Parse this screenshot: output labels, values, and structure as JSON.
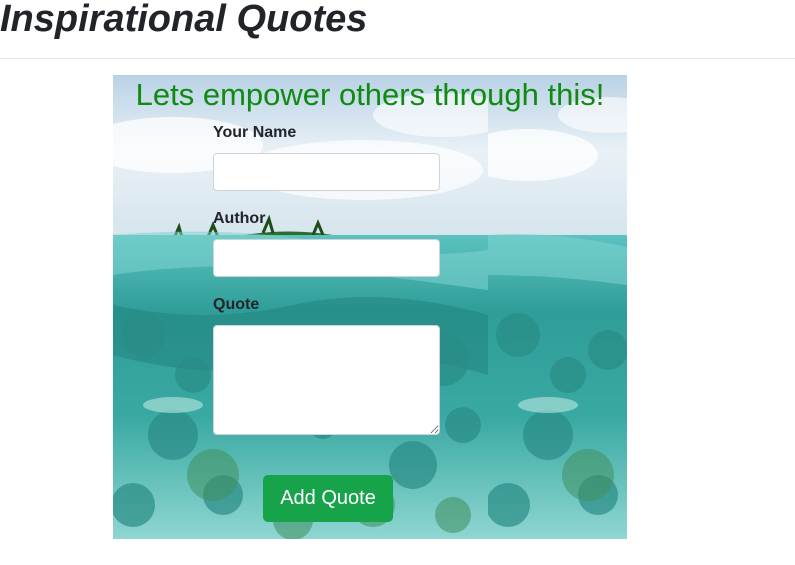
{
  "page": {
    "title": "Inspirational Quotes"
  },
  "hero": {
    "heading": "Lets empower others through this!",
    "heading_color": "#118a11",
    "background_image": "tropical-underwater-reef-scene"
  },
  "form": {
    "name_label": "Your Name",
    "name_value": "",
    "author_label": "Author",
    "author_value": "",
    "quote_label": "Quote",
    "quote_value": "",
    "submit_label": "Add Quote",
    "submit_color": "#16a34a"
  }
}
